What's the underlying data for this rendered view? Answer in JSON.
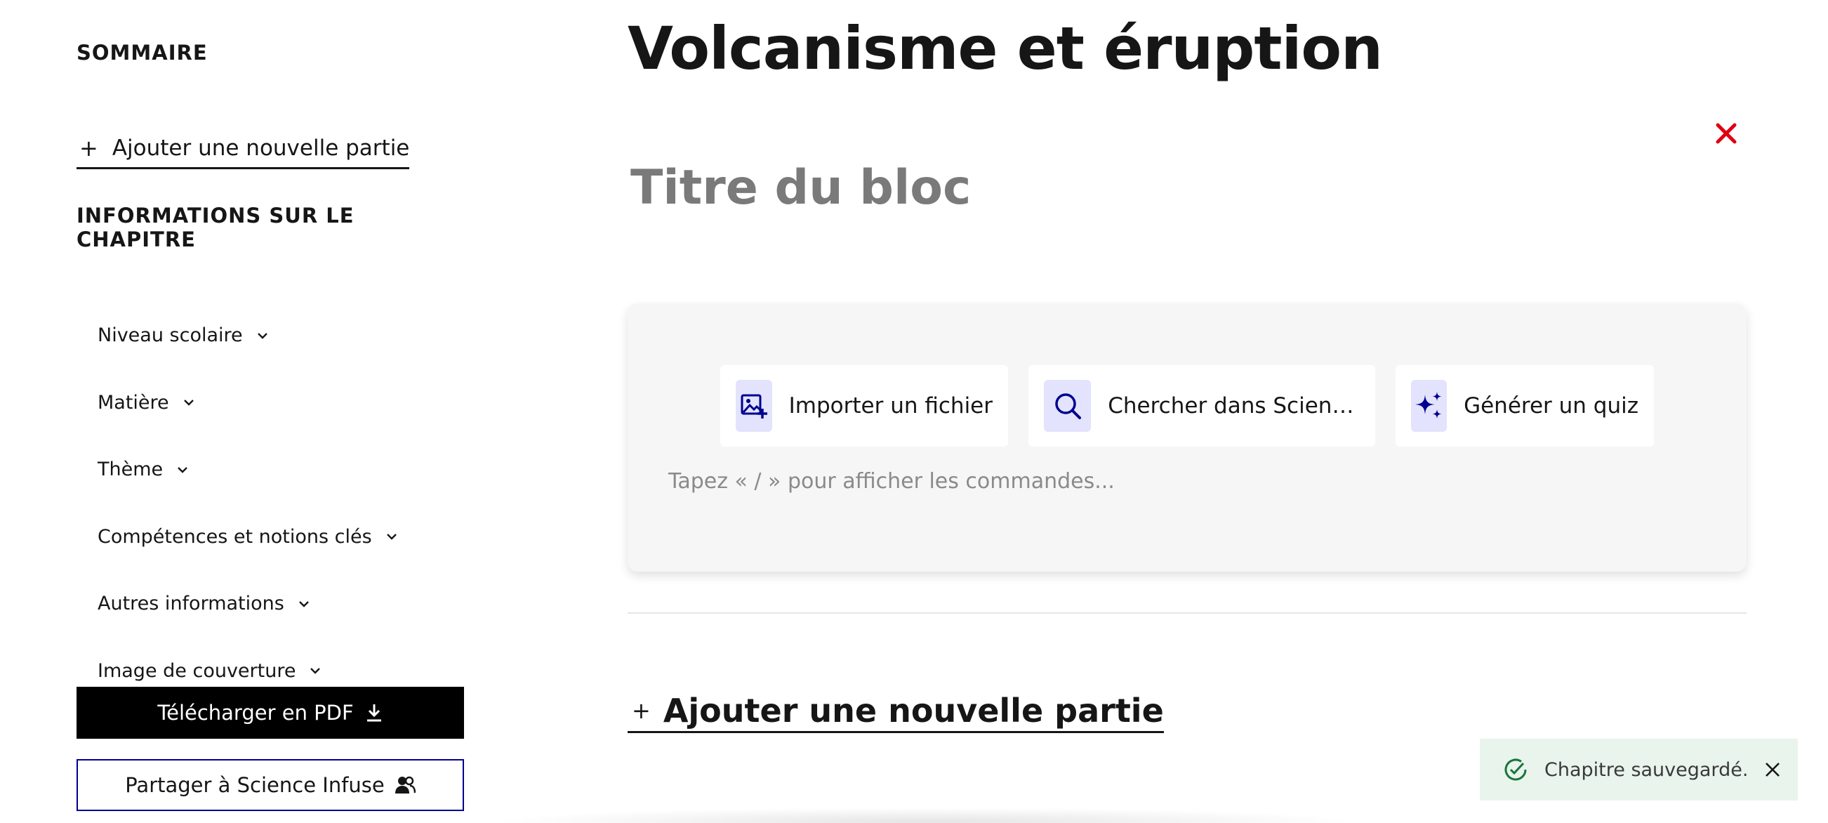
{
  "sidebar": {
    "heading": "SOMMAIRE",
    "add_part_label": "Ajouter une nouvelle partie",
    "add_part_plus": "+",
    "chapter_info_heading": "INFORMATIONS SUR LE CHAPITRE",
    "items": [
      {
        "label": "Niveau scolaire"
      },
      {
        "label": "Matière"
      },
      {
        "label": "Thème"
      },
      {
        "label": "Compétences et notions clés"
      },
      {
        "label": "Autres informations"
      },
      {
        "label": "Image de couverture"
      }
    ],
    "download_pdf_label": "Télécharger en PDF",
    "share_label": "Partager à Science Infuse"
  },
  "main": {
    "title": "Volcanisme et éruption",
    "block_title_placeholder": "Titre du bloc",
    "actions": [
      {
        "label": "Importer un fichier",
        "icon": "image-add-icon"
      },
      {
        "label": "Chercher dans Science ...",
        "icon": "search-icon"
      },
      {
        "label": "Générer un quiz",
        "icon": "sparkles-icon"
      }
    ],
    "editor_placeholder": "Tapez « / » pour afficher les commandes...",
    "add_part_label": "Ajouter une nouvelle partie",
    "add_part_plus": "+"
  },
  "toast": {
    "message": "Chapitre sauvegardé."
  },
  "colors": {
    "accent_blue": "#000091",
    "icon_bg": "#e3e3fd",
    "close_red": "#e1000f",
    "toast_bg": "#e8f4ec",
    "toast_green": "#18753c"
  }
}
